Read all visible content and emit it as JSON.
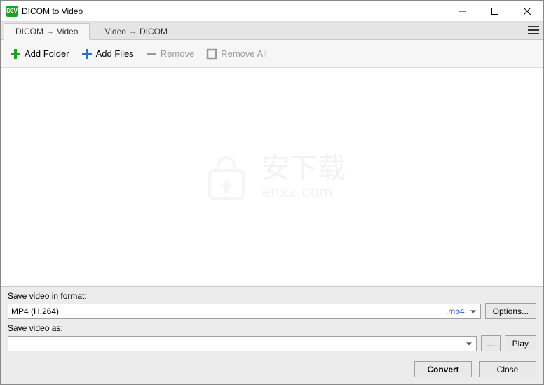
{
  "window": {
    "title": "DICOM to Video",
    "icon_text": "D2V"
  },
  "tabs": {
    "tab1_left": "DICOM",
    "tab1_right": "Video",
    "tab2_left": "Video",
    "tab2_right": "DICOM"
  },
  "toolbar": {
    "add_folder": "Add Folder",
    "add_files": "Add Files",
    "remove": "Remove",
    "remove_all": "Remove All"
  },
  "watermark": {
    "line1": "安下载",
    "line2": "anxz.com"
  },
  "bottom": {
    "format_label": "Save video in format:",
    "format_value": "MP4 (H.264)",
    "format_ext": ".mp4",
    "options": "Options...",
    "saveas_label": "Save video as:",
    "saveas_value": "",
    "browse": "...",
    "play": "Play"
  },
  "footer": {
    "convert": "Convert",
    "close": "Close"
  }
}
